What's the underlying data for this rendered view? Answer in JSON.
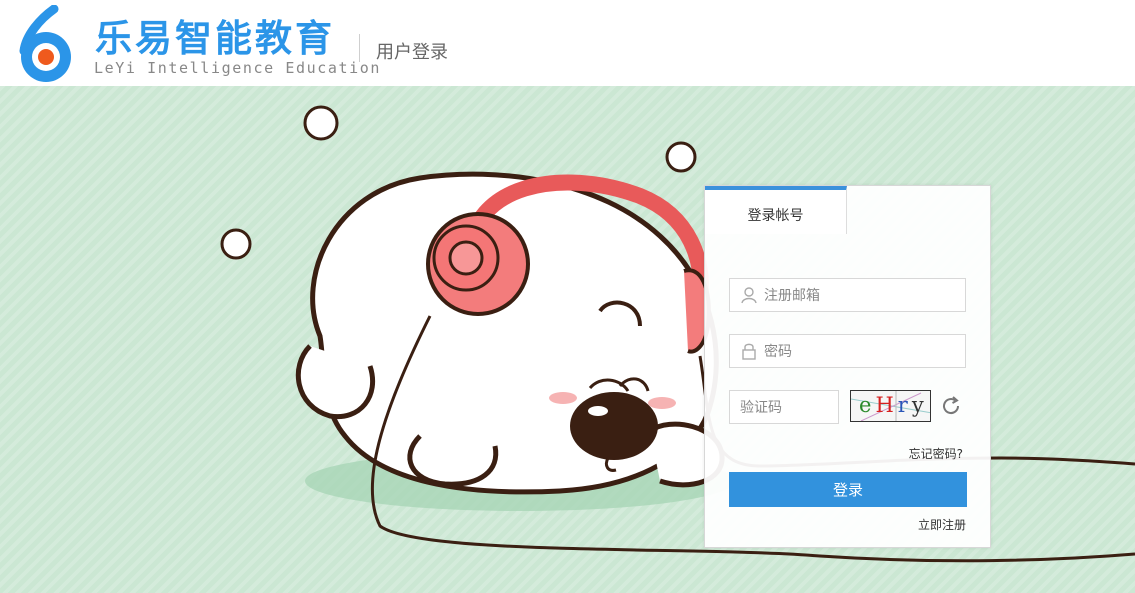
{
  "header": {
    "logo_cn": "乐易智能教育",
    "logo_en": "LeYi Intelligence Education",
    "page_title": "用户登录"
  },
  "login": {
    "tab_label": "登录帐号",
    "email_placeholder": "注册邮箱",
    "password_placeholder": "密码",
    "captcha_placeholder": "验证码",
    "captcha_text": "eHry",
    "forgot_label": "忘记密码?",
    "submit_label": "登录",
    "register_label": "立即注册"
  },
  "colors": {
    "brand_blue": "#2b95e8",
    "accent_orange": "#ef5a1d",
    "button_blue": "#3292dd",
    "banner_green": "#cbe7d3"
  },
  "icons": {
    "user": "user-icon",
    "lock": "lock-icon",
    "refresh": "refresh-icon"
  }
}
